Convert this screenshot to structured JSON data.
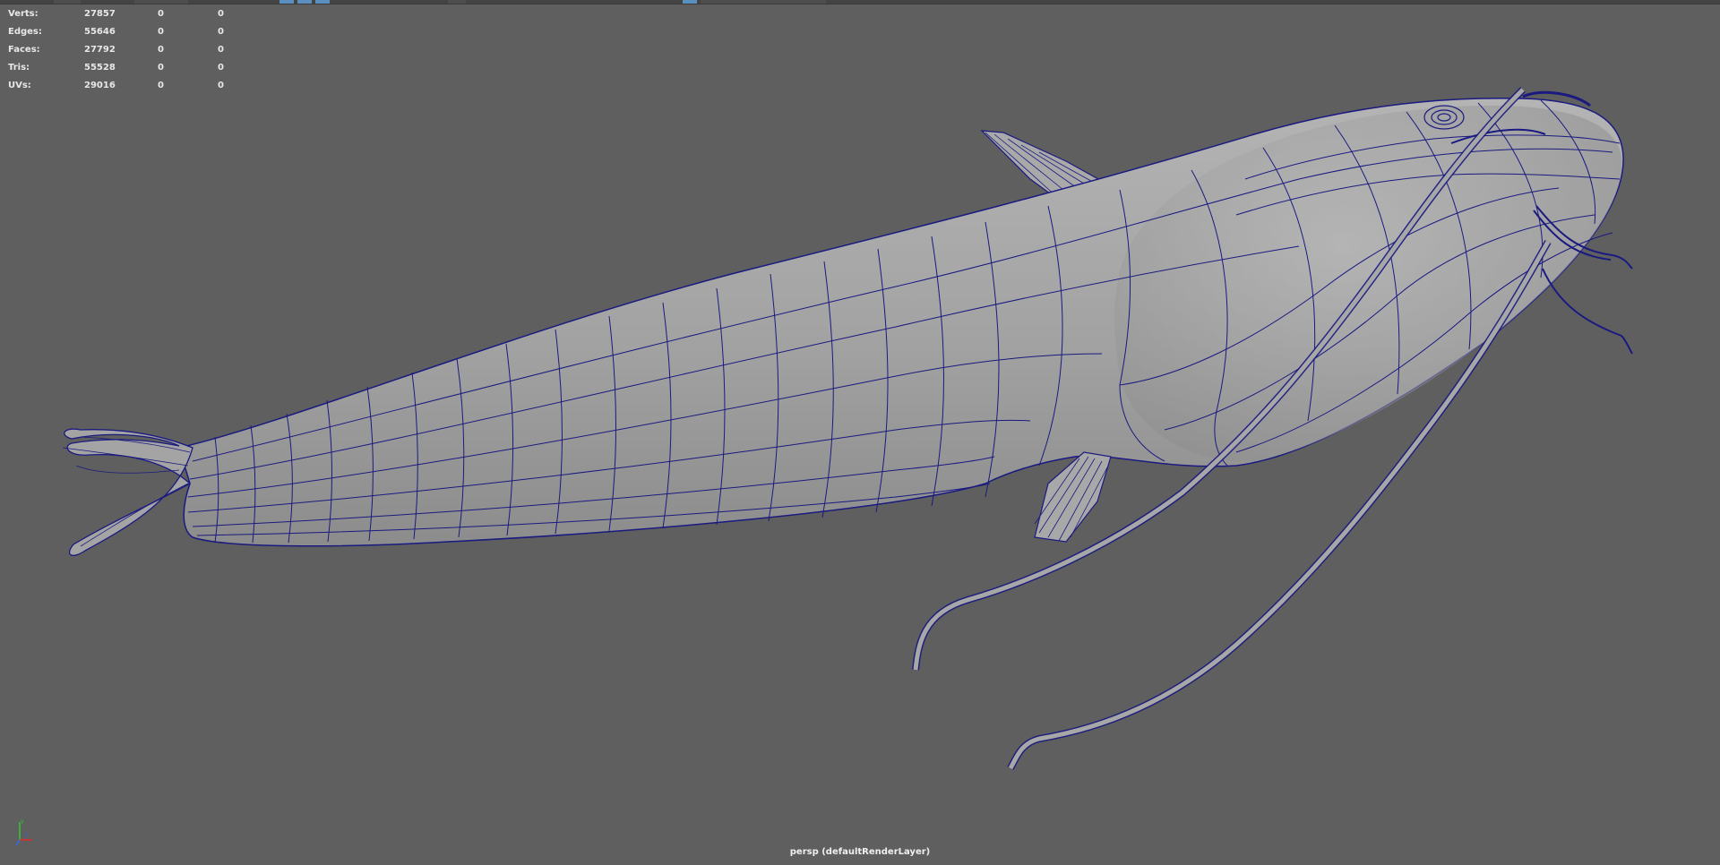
{
  "hud": {
    "rows": [
      {
        "label": "Verts:",
        "v1": "27857",
        "v2": "0",
        "v3": "0"
      },
      {
        "label": "Edges:",
        "v1": "55646",
        "v2": "0",
        "v3": "0"
      },
      {
        "label": "Faces:",
        "v1": "27792",
        "v2": "0",
        "v3": "0"
      },
      {
        "label": "Tris:",
        "v1": "55528",
        "v2": "0",
        "v3": "0"
      },
      {
        "label": "UVs:",
        "v1": "29016",
        "v2": "0",
        "v3": "0"
      }
    ]
  },
  "viewport": {
    "camera_label": "persp (defaultRenderLayer)",
    "background": "#5f5f5f",
    "wire_color": "#1a1a80",
    "mesh_color": "#a8a8a8"
  },
  "axis": {
    "x": "x",
    "y": "y",
    "z": "z"
  },
  "icons": [
    "axis-gizmo-icon"
  ]
}
